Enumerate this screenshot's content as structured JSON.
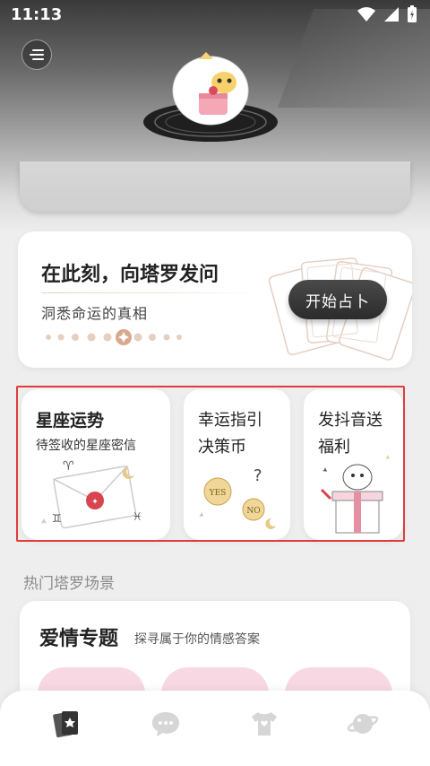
{
  "status": {
    "time": "11:13"
  },
  "hero": {
    "menu_icon": "menu-icon"
  },
  "tarot": {
    "title": "在此刻，向塔罗发问",
    "subtitle": "洞悉命运的真相",
    "button_label": "开始占卜"
  },
  "features": [
    {
      "title": "星座运势",
      "subtitle": "待签收的星座密信"
    },
    {
      "line1": "幸运指引",
      "line2": "决策币"
    },
    {
      "line1": "发抖音送",
      "line2": "福利"
    }
  ],
  "section": {
    "title": "热门塔罗场景"
  },
  "love": {
    "title": "爱情专题",
    "subtitle": "探寻属于你的情感答案"
  },
  "tabs": [
    {
      "icon": "tarot-cards-icon",
      "active": true
    },
    {
      "icon": "chat-bubble-icon",
      "active": false
    },
    {
      "icon": "tshirt-icon",
      "active": false
    },
    {
      "icon": "planet-icon",
      "active": false
    }
  ],
  "colors": {
    "accent": "#2b2b2b",
    "highlight": "#e23b3b",
    "pink": "#f8d9e3",
    "gold": "#e7c989"
  }
}
